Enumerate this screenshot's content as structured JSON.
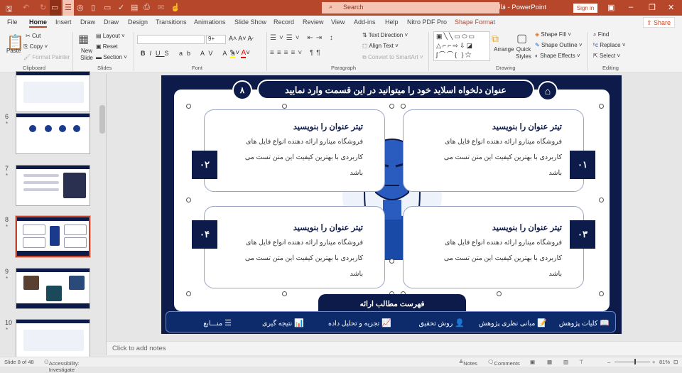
{
  "app": {
    "title": "قالب پاورپوینت هوش مصنوعی-مینارو  -  PowerPoint",
    "search_placeholder": "Search",
    "sign_in": "Sign in",
    "share": "Share",
    "accent": "#b7472a",
    "slide_navy": "#0d1b4b"
  },
  "quick_access": [
    "save-icon",
    "undo-icon",
    "redo-icon",
    "present-icon",
    "outline-icon",
    "palette-icon",
    "new-icon",
    "open-icon",
    "spell-icon",
    "print-preview-icon",
    "print-icon",
    "email-icon",
    "touch-icon"
  ],
  "tabs": [
    "File",
    "Home",
    "Insert",
    "Draw",
    "Draw",
    "Design",
    "Transitions",
    "Animations",
    "Slide Show",
    "Record",
    "Review",
    "View",
    "Add-ins",
    "Help",
    "Nitro PDF Pro",
    "Shape Format"
  ],
  "ribbon": {
    "clipboard": {
      "label": "Clipboard",
      "paste": "Paste",
      "cut": "Cut",
      "copy": "Copy",
      "format_painter": "Format Painter"
    },
    "slides": {
      "label": "Slides",
      "new_slide": "New Slide",
      "layout": "Layout",
      "reset": "Reset",
      "section": "Section"
    },
    "font": {
      "label": "Font",
      "font_name": "",
      "font_size": "9+"
    },
    "paragraph": {
      "label": "Paragraph",
      "text_direction": "Text Direction",
      "align_text": "Align Text",
      "convert_smartart": "Convert to SmartArt"
    },
    "drawing": {
      "label": "Drawing",
      "arrange": "Arrange",
      "quick_styles": "Quick Styles",
      "shape_fill": "Shape Fill",
      "shape_outline": "Shape Outline",
      "shape_effects": "Shape Effects"
    },
    "editing": {
      "label": "Editing",
      "find": "Find",
      "replace": "Replace",
      "select": "Select"
    }
  },
  "thumbnails": [
    {
      "num": "6"
    },
    {
      "num": "7"
    },
    {
      "num": "8",
      "selected": true
    },
    {
      "num": "9"
    },
    {
      "num": "10"
    }
  ],
  "slide": {
    "title": "عنوان دلخواه اسلاید خود را میتوانید در این قسمت وارد نمایید",
    "page_number": "۸",
    "cards": [
      {
        "num": "۰۱",
        "title": "تیتر عنوان را بنویسید",
        "body": "فروشگاه مینارو ارائه دهنده انواع فایل های کاربردی با بهترین کیفیت این متن تست می باشد"
      },
      {
        "num": "۰۲",
        "title": "تیتر عنوان را بنویسید",
        "body": "فروشگاه مینارو ارائه دهنده انواع فایل های کاربردی با بهترین کیفیت این متن تست می باشد"
      },
      {
        "num": "۰۳",
        "title": "تیتر عنوان را بنویسید",
        "body": "فروشگاه مینارو ارائه دهنده انواع فایل های کاربردی با بهترین کیفیت این متن تست می باشد"
      },
      {
        "num": "۰۴",
        "title": "تیتر عنوان را بنویسید",
        "body": "فروشگاه مینارو ارائه دهنده انواع فایل های کاربردی با بهترین کیفیت این متن تست می باشد"
      }
    ],
    "nav_title": "فهرست مطالب ارائه",
    "nav_items": [
      {
        "label": "کلیات پژوهش",
        "icon": "book-icon"
      },
      {
        "label": "مبانی نظری پژوهش",
        "icon": "document-icon"
      },
      {
        "label": "روش تحقیق",
        "icon": "person-icon"
      },
      {
        "label": "تجزیه و تحلیل داده",
        "icon": "chart-icon"
      },
      {
        "label": "نتیجه گیری",
        "icon": "presentation-icon"
      },
      {
        "label": "منـــابع",
        "icon": "list-icon"
      }
    ]
  },
  "notes_placeholder": "Click to add notes",
  "status": {
    "slide": "Slide 8 of 48",
    "accessibility": "Accessibility: Investigate",
    "notes": "Notes",
    "comments": "Comments",
    "zoom": "81%"
  }
}
